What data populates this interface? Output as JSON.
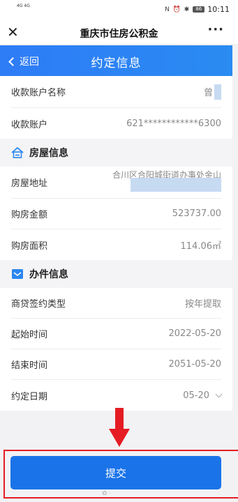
{
  "status_bar": {
    "left_text": "4G 4G",
    "time": "10:11",
    "battery": "86",
    "icons": "N ⏰ ✱"
  },
  "app_bar": {
    "close_glyph": "✕",
    "title": "重庆市住房公积金",
    "more_glyph": "···"
  },
  "nav": {
    "back_label": "返回",
    "title": "约定信息"
  },
  "account": [
    {
      "label": "收款账户名称",
      "value": "曾"
    },
    {
      "label": "收款账户",
      "value": "621************6300"
    }
  ],
  "house_section": {
    "title": "房屋信息",
    "icon": "house-icon"
  },
  "house": {
    "address_label": "房屋地址",
    "address_value": "合川区合阳城街道办事处金山",
    "amount_label": "购房金额",
    "amount_value": "523737.00",
    "area_label": "购房面积",
    "area_value": "114.06㎡"
  },
  "business_section": {
    "title": "办件信息",
    "icon": "envelope-icon"
  },
  "business": {
    "type_label": "商贷签约类型",
    "type_value": "按年提取",
    "start_label": "起始时间",
    "start_value": "2022-05-20",
    "end_label": "结束时间",
    "end_value": "2051-05-20",
    "date_label": "约定日期",
    "date_value": "05-20"
  },
  "submit_label": "提交",
  "colors": {
    "primary": "#1a73e8",
    "annotation": "#e51c23"
  }
}
